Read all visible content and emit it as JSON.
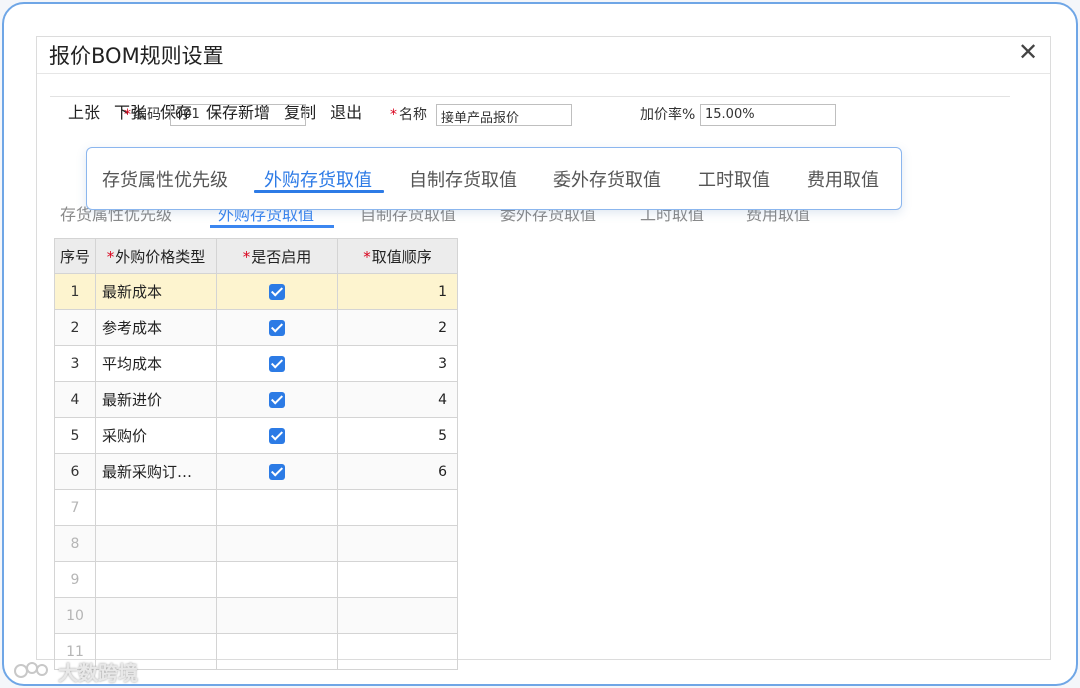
{
  "dialog": {
    "title": "报价BOM规则设置",
    "close_glyph": "✕"
  },
  "toolbar": {
    "prev": "上张",
    "next": "下张",
    "save": "保存",
    "save_new": "保存新增",
    "copy": "复制",
    "exit": "退出"
  },
  "form": {
    "code_label": "编码",
    "code_value": "001",
    "name_label": "名称",
    "name_value": "接单产品报价",
    "markup_label": "加价率%",
    "markup_value": "15.00%"
  },
  "tabs": [
    {
      "label": "存货属性优先级",
      "active": false
    },
    {
      "label": "外购存货取值",
      "active": true
    },
    {
      "label": "自制存货取值",
      "active": false
    },
    {
      "label": "委外存货取值",
      "active": false
    },
    {
      "label": "工时取值",
      "active": false
    },
    {
      "label": "费用取值",
      "active": false
    }
  ],
  "grid": {
    "headers": {
      "index": "序号",
      "price_type": "外购价格类型",
      "enabled": "是否启用",
      "order": "取值顺序"
    },
    "rows": [
      {
        "index": "1",
        "price_type": "最新成本",
        "enabled": true,
        "order": "1"
      },
      {
        "index": "2",
        "price_type": "参考成本",
        "enabled": true,
        "order": "2"
      },
      {
        "index": "3",
        "price_type": "平均成本",
        "enabled": true,
        "order": "3"
      },
      {
        "index": "4",
        "price_type": "最新进价",
        "enabled": true,
        "order": "4"
      },
      {
        "index": "5",
        "price_type": "采购价",
        "enabled": true,
        "order": "5"
      },
      {
        "index": "6",
        "price_type": "最新采购订…",
        "enabled": true,
        "order": "6"
      }
    ],
    "empty_rows": [
      "7",
      "8",
      "9",
      "10",
      "11"
    ]
  },
  "watermark": {
    "text": "大数跨境"
  },
  "colors": {
    "accent": "#2d7be6",
    "selected_row": "#fdf4cf",
    "required_mark": "#d9001b",
    "frame_border": "#6fa6e6"
  }
}
